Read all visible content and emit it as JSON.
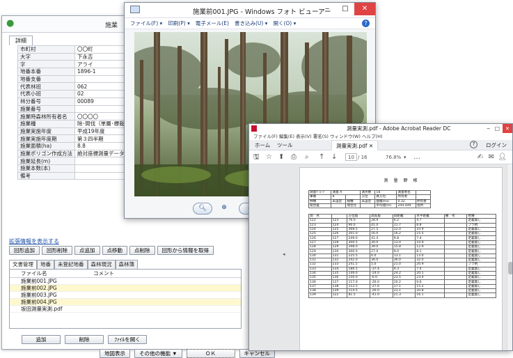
{
  "main_window": {
    "title": "施業",
    "tab": "詳細",
    "fields": [
      {
        "label": "市町村",
        "value": "〇〇町"
      },
      {
        "label": "大字",
        "value": "下永吉"
      },
      {
        "label": "字",
        "value": "アライ"
      },
      {
        "label": "地番本番",
        "value": "1896-1"
      },
      {
        "label": "地番支番",
        "value": ""
      },
      {
        "label": "代表林班",
        "value": "062"
      },
      {
        "label": "代表小班",
        "value": "02"
      },
      {
        "label": "林分番号",
        "value": "00089"
      },
      {
        "label": "施業番号",
        "value": ""
      },
      {
        "label": "施業時森林所有者名",
        "value": "〇〇〇〇"
      },
      {
        "label": "施業種",
        "value": "除･間伐（単層･標栽）"
      },
      {
        "label": "施業実施年度",
        "value": "平成19年度"
      },
      {
        "label": "施業実施年度期",
        "value": "第３四半期"
      },
      {
        "label": "施業面積(ha)",
        "value": "8.8"
      },
      {
        "label": "施業ポリゴン作成方法",
        "value": "絶対座標測量データ入力"
      },
      {
        "label": "施業延長(m)",
        "value": ""
      },
      {
        "label": "施業本数(本)",
        "value": ""
      },
      {
        "label": "備考",
        "value": ""
      }
    ],
    "expand_link": "拡張情報を表示する",
    "shape_buttons": [
      "回形追加",
      "回形削除",
      "点追加",
      "点移動",
      "点削除",
      "回形から情報を取得"
    ],
    "sub_tabs": [
      "文書管理",
      "地番",
      "未登記地番",
      "森林現況",
      "森林簿"
    ],
    "list_headers": {
      "file": "ファイル名",
      "comment": "コメント"
    },
    "files": [
      "施業前001.JPG",
      "施業前002.JPG",
      "施業前003.JPG",
      "施業前004.JPG",
      "坂田測量実測.pdf"
    ],
    "file_buttons": {
      "add": "追加",
      "delete": "削除",
      "open": "ﾌｧｲﾙを開く"
    },
    "bottom_buttons": {
      "map": "地図表示",
      "other": "その他の機能 ▼",
      "ok": "ＯＫ",
      "cancel": "キャンセル"
    }
  },
  "photo_viewer": {
    "title": "施業前001.JPG - Windows フォト ビューアー",
    "menu": [
      "ファイル(F) ▾",
      "印刷(P) ▾",
      "電子メール(E)",
      "書き込み(U) ▾",
      "開く(O) ▾"
    ],
    "help": "?"
  },
  "pdf_viewer": {
    "title": "測量実測.pdf - Adobe Acrobat Reader DC",
    "menu": "ファイル(F)  編集(E)  表示(V)  署名(S)  ウィンドウ(W)  ヘルプ(H)",
    "tab_home": "ホーム",
    "tab_tools": "ツール",
    "tab_doc": "測量実測.pdf",
    "login": "ログイン",
    "page_current": "10",
    "page_total": "/ 16",
    "zoom": "76.8%",
    "doc_heading": "測　量　野　帳",
    "survey_rows": [
      [
        "122",
        "123",
        "76.0",
        "28.9",
        "6.2",
        "4.7",
        "定義無し"
      ],
      [
        "123",
        "124",
        "90.0",
        "41.0",
        "11.7",
        "8.8",
        "プラ杭"
      ],
      [
        "124",
        "125",
        "368.5",
        "27.5",
        "12.0",
        "10.9",
        "定義無し"
      ],
      [
        "125",
        "126",
        "201.0",
        "16.0",
        "16.2",
        "15.5",
        "定義無し"
      ],
      [
        "126",
        "127",
        "249.0",
        "41.4",
        "9.8",
        "7.4",
        "定義無し"
      ],
      [
        "127",
        "128",
        "300.5",
        "30.0",
        "13.0",
        "10.9",
        "定義無し"
      ],
      [
        "128",
        "129",
        "298.0",
        "39.0",
        "15.8",
        "12.9",
        "定義無し"
      ],
      [
        "129",
        "130",
        "300.0",
        "27.0",
        "9.0",
        "8.1",
        "定義無し"
      ],
      [
        "130",
        "131",
        "225.5",
        "6.0",
        "13.1",
        "13.0",
        "定義無し"
      ],
      [
        "131",
        "132",
        "242.0",
        "36.0",
        "36.0",
        "32.0",
        "定義無し"
      ],
      [
        "132",
        "133",
        "241.5",
        "5.0",
        "21.0",
        "20.9",
        "プラ杭"
      ],
      [
        "133",
        "134",
        "186.5",
        "-37.4",
        "9.3",
        "7.4",
        "定義無し"
      ],
      [
        "134",
        "135",
        "149.0",
        "-24.0",
        "24.2",
        "20.1",
        "定義無し"
      ],
      [
        "135",
        "136",
        "150.0",
        "-6.0",
        "23.5",
        "23.4",
        "定義無し"
      ],
      [
        "136",
        "137",
        "117.0",
        "-26.0",
        "10.2",
        "9.6",
        "定義無し"
      ],
      [
        "137",
        "138",
        "112.5",
        "-27.6",
        "17.1",
        "15.2",
        "定義無し"
      ],
      [
        "138",
        "139",
        "114.5",
        "-26.0",
        "23.1",
        "20.8",
        "定義無し"
      ],
      [
        "139",
        "122",
        "81.5",
        "-41.0",
        "21.3",
        "16.1",
        "定義無し"
      ]
    ]
  },
  "colors": {
    "accent": "#2a6bc7",
    "close_red": "#e04343",
    "row_highlight": "#fff8cf"
  }
}
